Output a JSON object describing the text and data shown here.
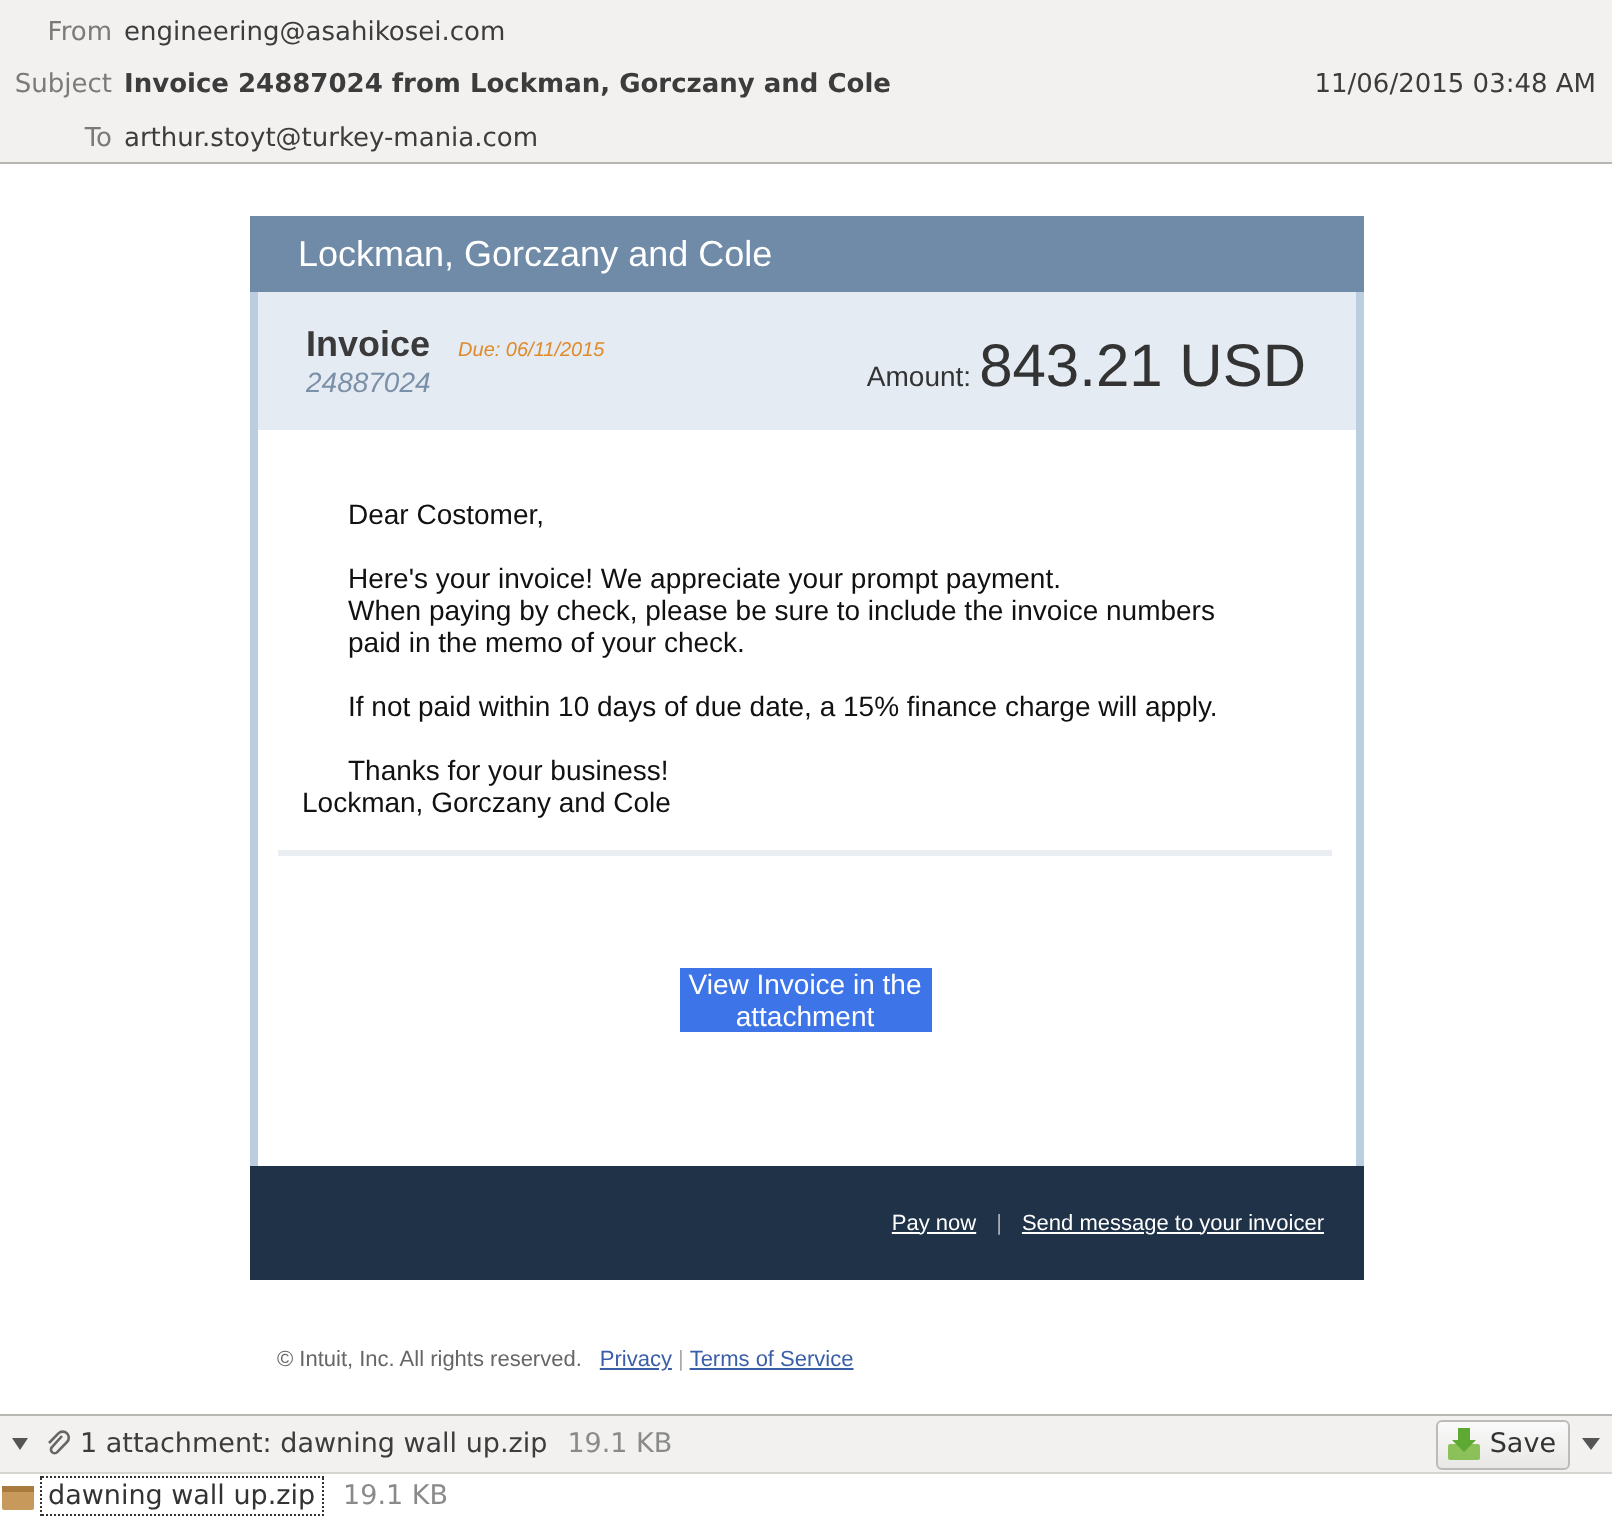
{
  "header": {
    "from_label": "From",
    "from": "engineering@asahikosei.com",
    "subject_label": "Subject",
    "subject": "Invoice 24887024 from Lockman, Gorczany and Cole",
    "date": "11/06/2015 03:48 AM",
    "to_label": "To",
    "to": "arthur.stoyt@turkey-mania.com"
  },
  "email": {
    "company": "Lockman, Gorczany and Cole",
    "invoice_label": "Invoice",
    "invoice_number": "24887024",
    "due": "Due: 06/11/2015",
    "amount_label": "Amount:",
    "amount": "843.21 USD",
    "greeting": "Dear Costomer,",
    "paragraphs": [
      "Here's your invoice! We appreciate your prompt payment.",
      "When paying by check, please be sure to include the invoice numbers paid in the memo of your check.",
      "If not paid within 10 days of due date, a 15% finance charge will apply."
    ],
    "thanks": "Thanks for your business!",
    "signature": "Lockman, Gorczany and Cole",
    "button": "View Invoice in the attachment",
    "footer_links": [
      "Pay now",
      "Send message to your invoicer"
    ],
    "footer_separator": "|",
    "copyright": "© Intuit, Inc. All rights reserved.",
    "legal_links": [
      "Privacy",
      "Terms of Service"
    ],
    "legal_separator": "|"
  },
  "attachments": {
    "expanded": true,
    "summary": "1 attachment: dawning wall up.zip",
    "summary_size": "19.1 KB",
    "save": "Save",
    "files": [
      {
        "name": "dawning wall up.zip",
        "size": "19.1 KB",
        "selected": true
      }
    ]
  }
}
